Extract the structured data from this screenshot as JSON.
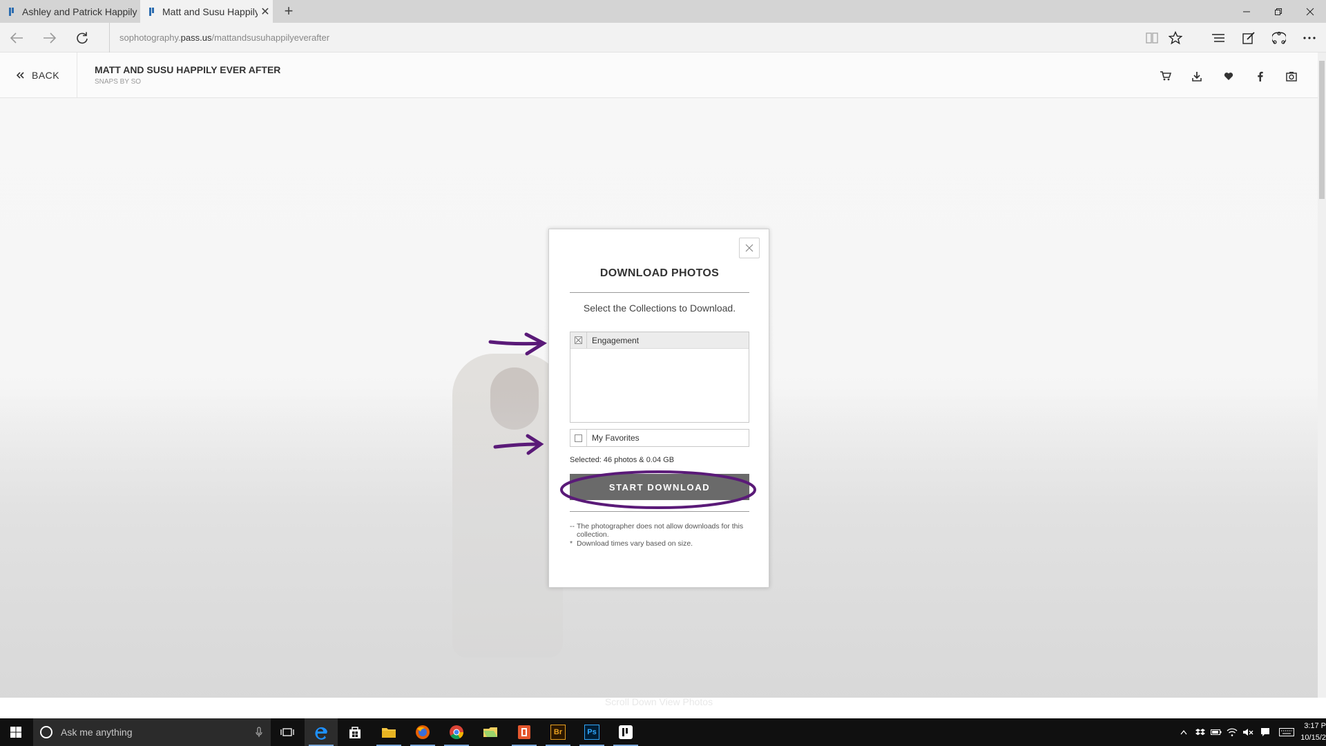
{
  "browser": {
    "tabs": [
      {
        "title": "Ashley and Patrick Happily E",
        "active": false
      },
      {
        "title": "Matt and Susu Happily E",
        "active": true
      }
    ],
    "new_tab": "+",
    "url_prefix": "sophotography.",
    "url_host": "pass.us",
    "url_path": "/mattandsusuhappilyeverafter"
  },
  "site": {
    "back_label": "BACK",
    "title": "MATT AND SUSU HAPPILY EVER AFTER",
    "subtitle": "SNAPS BY SO",
    "toolbar_icons": [
      "cart-icon",
      "download-icon",
      "heart-icon",
      "facebook-icon",
      "slideshow-icon"
    ],
    "scroll_hint": "Scroll Down   View Photos"
  },
  "modal": {
    "title": "DOWNLOAD PHOTOS",
    "instruction": "Select the Collections to Download.",
    "collections": [
      {
        "label": "Engagement",
        "disabled": true
      }
    ],
    "favorites_label": "My Favorites",
    "selected_text": "Selected: 46 photos & 0.04 GB",
    "start_button": "START DOWNLOAD",
    "notes": [
      {
        "mark": "--",
        "text": "The photographer does not allow downloads for this collection."
      },
      {
        "mark": "*",
        "text": "Download times vary based on size."
      }
    ]
  },
  "annotation_color": "#5a1a78",
  "taskbar": {
    "search_placeholder": "Ask me anything",
    "apps": [
      "task-view-icon",
      "edge-icon",
      "store-icon",
      "file-explorer-icon",
      "firefox-icon",
      "chrome-icon",
      "folder-icon",
      "office-icon",
      "bridge-icon",
      "photoshop-icon",
      "pass-icon"
    ],
    "bridge_label": "Br",
    "photoshop_label": "Ps",
    "clock_time": "3:17 P",
    "clock_date": "10/15/2"
  }
}
